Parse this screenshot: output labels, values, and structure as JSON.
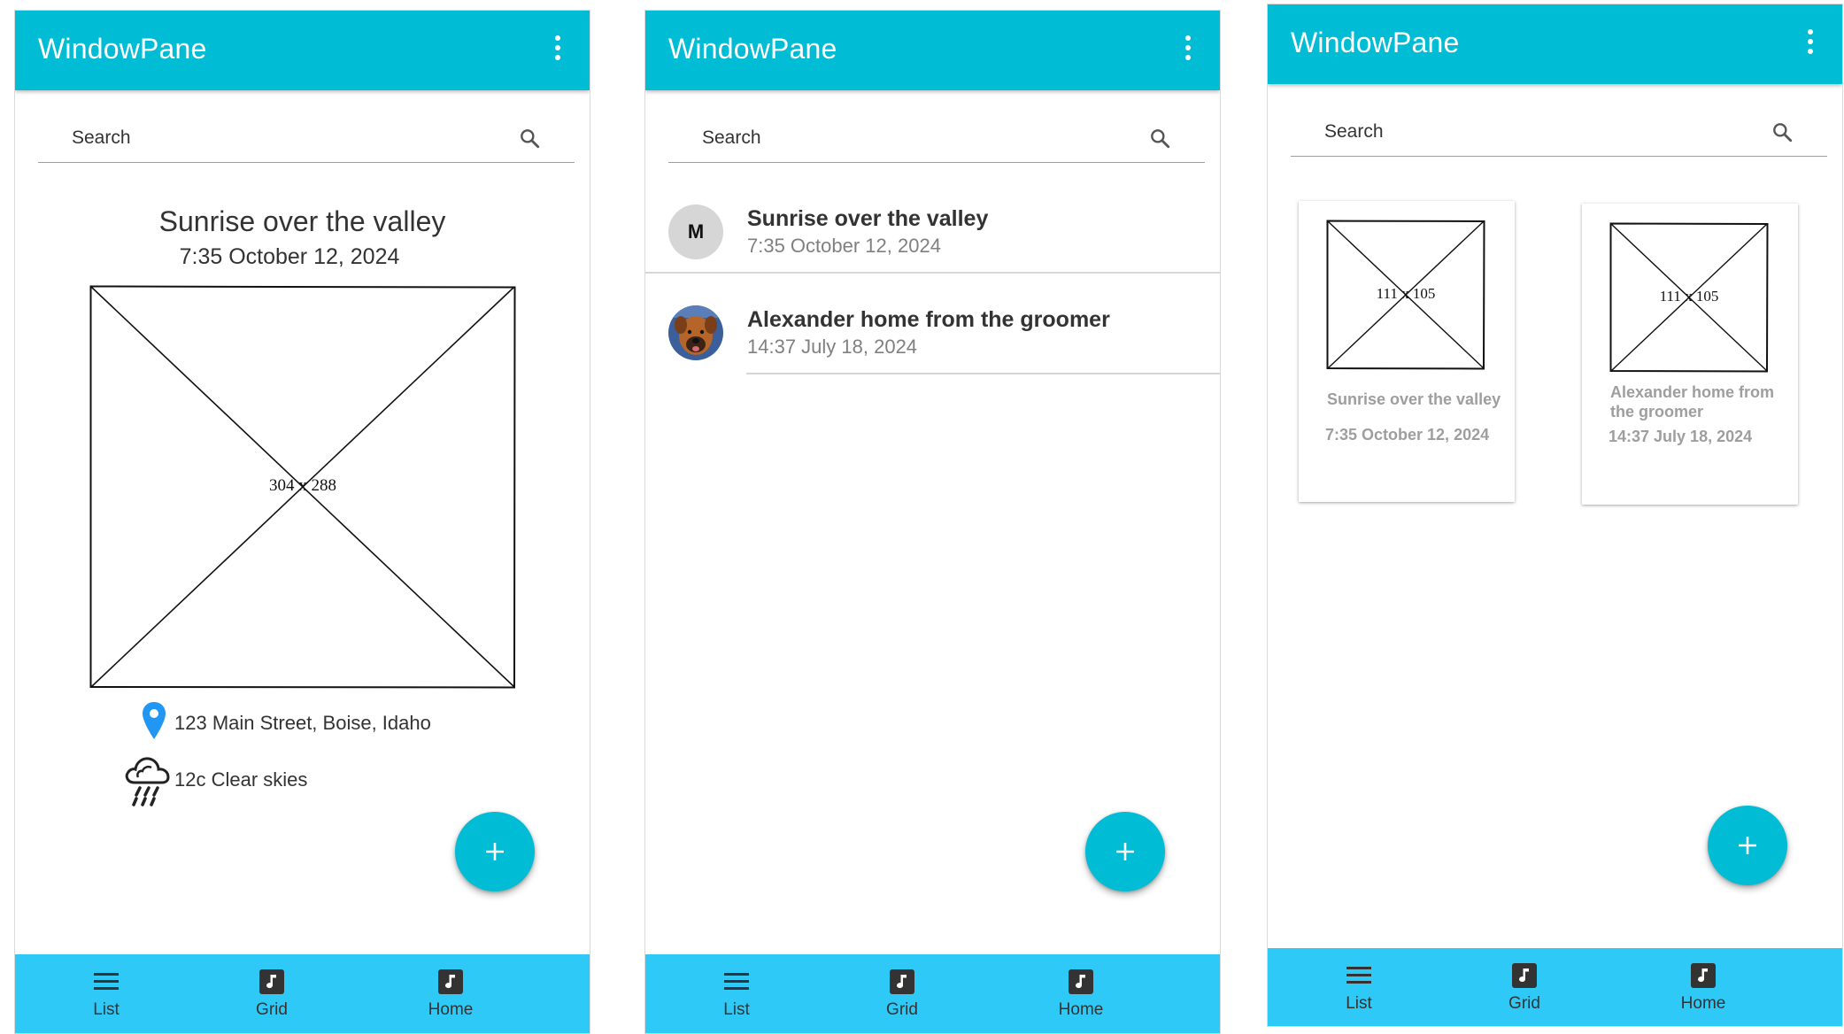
{
  "app": {
    "title": "WindowPane",
    "search_placeholder": "Search",
    "accent_color": "#00bcd4",
    "nav_color": "#2ec9f7"
  },
  "icons": {
    "more": "more-vert-icon",
    "search": "search-icon",
    "add": "add-icon",
    "list": "list-icon",
    "grid": "music-note-icon",
    "home": "music-note-icon",
    "location": "location-pin-icon",
    "weather": "rain-cloud-icon"
  },
  "bottom_nav": [
    {
      "label": "List"
    },
    {
      "label": "Grid"
    },
    {
      "label": "Home"
    }
  ],
  "detail": {
    "title": "Sunrise over the valley",
    "date": "7:35 October 12, 2024",
    "image_label": "304 x 288",
    "location": "123 Main Street, Boise, Idaho",
    "weather": "12c Clear skies"
  },
  "list": {
    "items": [
      {
        "avatar": "M",
        "title": "Sunrise over the valley",
        "date": "7:35 October 12, 2024"
      },
      {
        "avatar": "",
        "title": "Alexander home from the groomer",
        "date": "14:37 July 18, 2024"
      }
    ]
  },
  "grid": {
    "cards": [
      {
        "image_label": "111 x 105",
        "title": "Sunrise over the valley",
        "date": "7:35 October 12, 2024"
      },
      {
        "image_label": "111 x 105",
        "title": "Alexander home from the groomer",
        "date": "14:37 July 18, 2024"
      }
    ]
  }
}
